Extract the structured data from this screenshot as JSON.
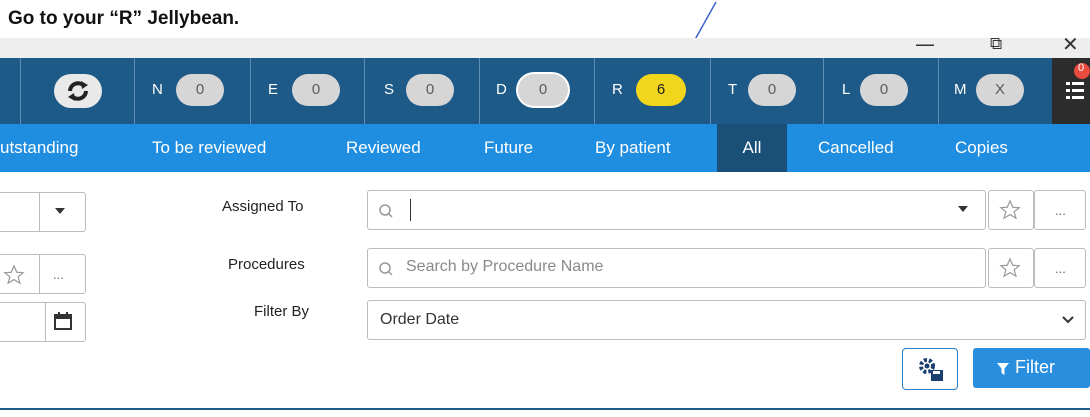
{
  "instruction": "Go to your “R” Jellybean.",
  "window_controls": {
    "minimize": "—",
    "restore": "⧉",
    "close": "✕"
  },
  "jellybeans": [
    {
      "letter": "N",
      "count": "0"
    },
    {
      "letter": "E",
      "count": "0"
    },
    {
      "letter": "S",
      "count": "0"
    },
    {
      "letter": "D",
      "count": "0"
    },
    {
      "letter": "R",
      "count": "6"
    },
    {
      "letter": "T",
      "count": "0"
    },
    {
      "letter": "L",
      "count": "0"
    },
    {
      "letter": "M",
      "count": "X"
    }
  ],
  "menu_badge": "0",
  "tabs": [
    {
      "label": "utstanding"
    },
    {
      "label": "To be reviewed"
    },
    {
      "label": "Reviewed"
    },
    {
      "label": "Future"
    },
    {
      "label": "By patient"
    },
    {
      "label": "All"
    },
    {
      "label": "Cancelled"
    },
    {
      "label": "Copies"
    }
  ],
  "form": {
    "assigned_to_label": "Assigned To",
    "assigned_to_value": "",
    "procedures_label": "Procedures",
    "procedures_placeholder": "Search by Procedure Name",
    "filter_by_label": "Filter By",
    "filter_by_value": "Order Date",
    "more_dots": "..."
  },
  "filter_button_label": "Filter",
  "colors": {
    "jellybar_bg": "#1e5a87",
    "tabs_bg": "#1f8de0",
    "active_tab_bg": "#1a4f77",
    "r_pill": "#f2d61c",
    "filter_button": "#2a8ede"
  },
  "icons": {
    "refresh": "refresh-icon",
    "menu": "list-menu-icon",
    "search": "search-icon",
    "star": "star-icon",
    "calendar": "calendar-icon",
    "chevron": "chevron-down-icon",
    "filter": "funnel-icon",
    "settings": "gear-save-icon"
  }
}
